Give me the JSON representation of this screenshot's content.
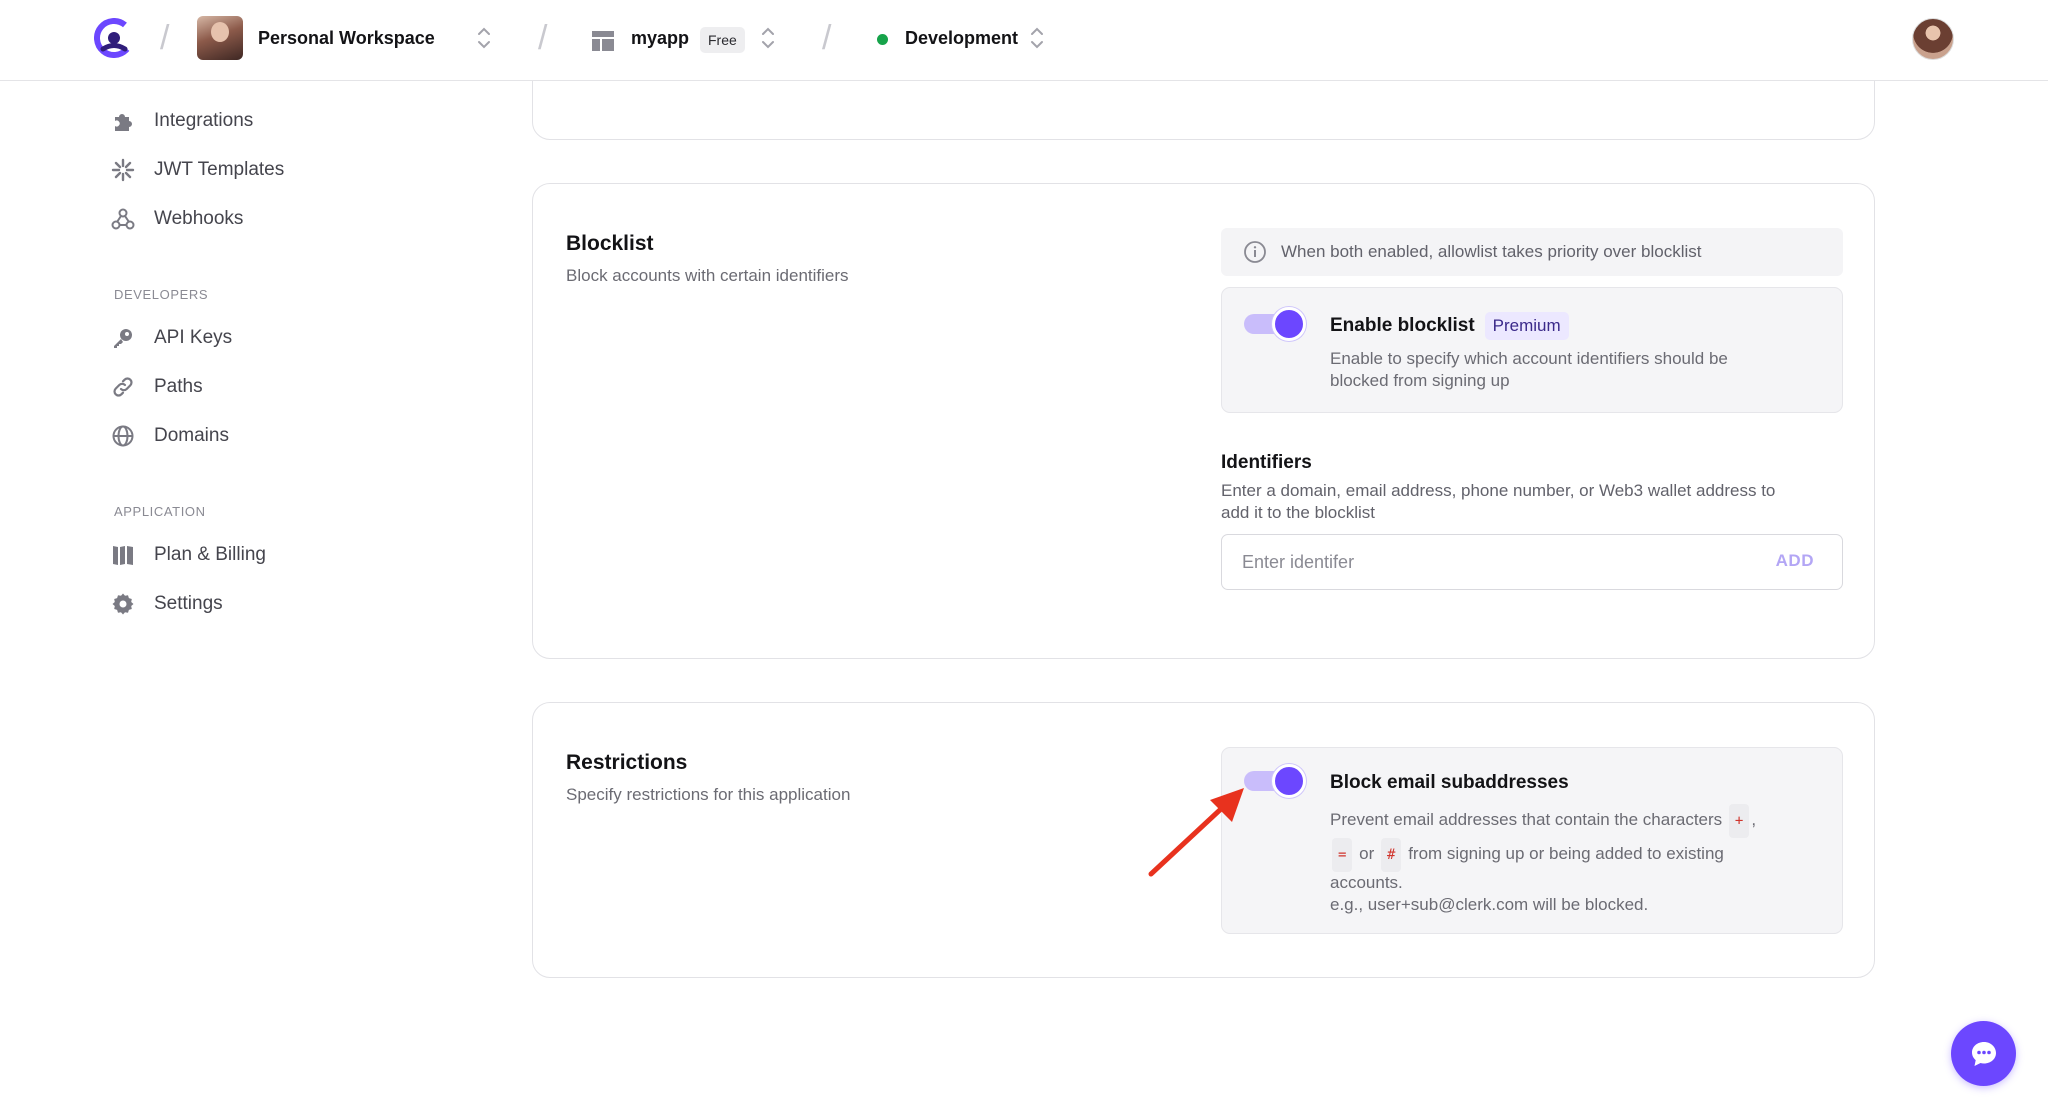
{
  "topbar": {
    "workspace": "Personal Workspace",
    "app_name": "myapp",
    "plan_badge": "Free",
    "environment": "Development",
    "separator": "/"
  },
  "sidebar": {
    "top_items": [
      {
        "label": "Integrations",
        "icon": "puzzle-icon"
      },
      {
        "label": "JWT Templates",
        "icon": "jwt-icon"
      },
      {
        "label": "Webhooks",
        "icon": "webhook-icon"
      }
    ],
    "developers_label": "DEVELOPERS",
    "developer_items": [
      {
        "label": "API Keys",
        "icon": "key-icon"
      },
      {
        "label": "Paths",
        "icon": "link-icon"
      },
      {
        "label": "Domains",
        "icon": "globe-icon"
      }
    ],
    "application_label": "APPLICATION",
    "application_items": [
      {
        "label": "Plan & Billing",
        "icon": "billing-icon"
      },
      {
        "label": "Settings",
        "icon": "gear-icon"
      }
    ]
  },
  "blocklist": {
    "title": "Blocklist",
    "subtitle": "Block accounts with certain identifiers",
    "info": "When both enabled, allowlist takes priority over blocklist",
    "toggle_title": "Enable blocklist",
    "premium_badge": "Premium",
    "toggle_desc_1": "Enable to specify which account identifiers should be",
    "toggle_desc_2": "blocked from signing up",
    "toggle_enabled": true,
    "identifiers_title": "Identifiers",
    "identifiers_desc_1": "Enter a domain, email address, phone number, or Web3 wallet address to",
    "identifiers_desc_2": "add it to the blocklist",
    "input_placeholder": "Enter identifer",
    "add_label": "ADD"
  },
  "restrictions": {
    "title": "Restrictions",
    "subtitle": "Specify restrictions for this application",
    "toggle_title": "Block email subaddresses",
    "toggle_enabled": true,
    "desc_1": "Prevent email addresses that contain the characters",
    "char_plus": "+",
    "comma": ",",
    "char_equals": "=",
    "or_word": "or",
    "char_hash": "#",
    "desc_2": "from signing up or being added to existing",
    "desc_3": "accounts.",
    "example": "e.g., user+sub@clerk.com will be blocked."
  },
  "colors": {
    "accent": "#6c47ff",
    "toggle_track": "#c9bdfb",
    "env_dot": "#16a34a",
    "annotation_arrow": "#e8321e"
  }
}
